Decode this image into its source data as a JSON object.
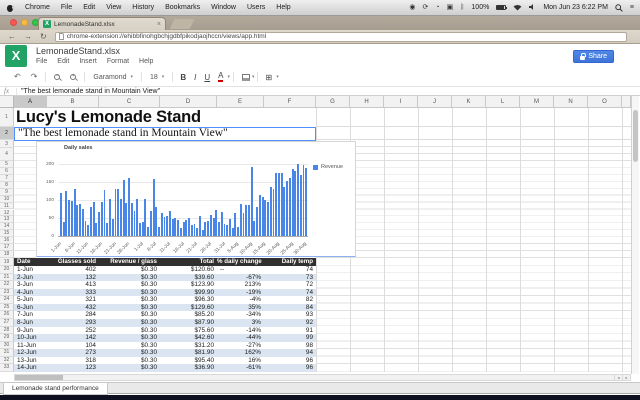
{
  "menubar": {
    "items": [
      "Chrome",
      "File",
      "Edit",
      "View",
      "History",
      "Bookmarks",
      "Window",
      "Users",
      "Help"
    ],
    "battery_label": "100%",
    "clock": "Mon Jun 23  6:22 PM"
  },
  "browser": {
    "tab_title": "LemonadeStand.xlsx",
    "tab_close": "×",
    "url": "chrome-extension://ehibbfinohgbchjgdbfpikodjaojhccn/views/app.html"
  },
  "app": {
    "logo_letter": "X",
    "title": "LemonadeStand.xlsx",
    "menus": [
      "File",
      "Edit",
      "Insert",
      "Format",
      "Help"
    ],
    "share_label": "Share",
    "toolbar": {
      "undo": "↶",
      "redo": "↷",
      "font_name": "Garamond",
      "font_size": "18",
      "bold": "B",
      "italic": "I",
      "underline": "U",
      "text_color": "A",
      "borders": "⊞",
      "caret": "▾"
    }
  },
  "formula_bar": {
    "fx_label": "fx",
    "value": "\"The best lemonade stand in Mountain View\""
  },
  "sheet": {
    "column_letters": [
      "A",
      "B",
      "C",
      "D",
      "E",
      "F",
      "G",
      "H",
      "I",
      "J",
      "K",
      "L",
      "M",
      "N",
      "O"
    ],
    "selected_column": "A",
    "selected_row": "2",
    "row_numbers": [
      "1",
      "2",
      "3",
      "4",
      "5",
      "6",
      "7",
      "8",
      "9",
      "10",
      "11",
      "12",
      "13",
      "14",
      "15",
      "16",
      "17",
      "18",
      "19",
      "20",
      "21",
      "22",
      "23",
      "24",
      "25",
      "26",
      "27",
      "28",
      "29",
      "30",
      "31",
      "32",
      "33"
    ],
    "title_cell": "Lucy's Lemonade Stand",
    "subtitle_cell": "\"The best lemonade stand in Mountain View\"",
    "tab_name": "Lemonade stand performance",
    "table": {
      "headers": [
        "Date",
        "Glasses sold",
        "Revenue / glass",
        "Total",
        "% daily change",
        "Daily temp"
      ],
      "rows": [
        [
          "1-Jun",
          "402",
          "$0.30",
          "$120.60",
          "--",
          "74"
        ],
        [
          "2-Jun",
          "132",
          "$0.30",
          "$39.60",
          "-67%",
          "73"
        ],
        [
          "3-Jun",
          "413",
          "$0.30",
          "$123.90",
          "213%",
          "72"
        ],
        [
          "4-Jun",
          "333",
          "$0.30",
          "$99.90",
          "-19%",
          "74"
        ],
        [
          "5-Jun",
          "321",
          "$0.30",
          "$96.30",
          "-4%",
          "82"
        ],
        [
          "6-Jun",
          "432",
          "$0.30",
          "$129.60",
          "35%",
          "84"
        ],
        [
          "7-Jun",
          "284",
          "$0.30",
          "$85.20",
          "-34%",
          "93"
        ],
        [
          "8-Jun",
          "293",
          "$0.30",
          "$87.90",
          "3%",
          "92"
        ],
        [
          "9-Jun",
          "252",
          "$0.30",
          "$75.60",
          "-14%",
          "91"
        ],
        [
          "10-Jun",
          "142",
          "$0.30",
          "$42.60",
          "-44%",
          "99"
        ],
        [
          "11-Jun",
          "104",
          "$0.30",
          "$31.20",
          "-27%",
          "98"
        ],
        [
          "12-Jun",
          "273",
          "$0.30",
          "$81.90",
          "162%",
          "94"
        ],
        [
          "13-Jun",
          "318",
          "$0.30",
          "$95.40",
          "16%",
          "96"
        ],
        [
          "14-Jun",
          "123",
          "$0.30",
          "$36.90",
          "-61%",
          "96"
        ]
      ]
    }
  },
  "chart_data": {
    "type": "bar",
    "title": "Daily sales",
    "legend": [
      "Revenue"
    ],
    "bar_color": "#4a86e8",
    "ylim": [
      0,
      200
    ],
    "yticks": [
      0,
      50,
      100,
      150,
      200
    ],
    "tick_every": 5,
    "tick_labels": [
      "1-Jun",
      "6-Jun",
      "11-Jun",
      "16-Jun",
      "21-Jun",
      "26-Jun",
      "1-Jul",
      "6-Jul",
      "11-Jul",
      "16-Jul",
      "21-Jul",
      "26-Jul",
      "31-Jul",
      "5-Aug",
      "10-Aug",
      "15-Aug",
      "20-Aug",
      "25-Aug",
      "30-Aug"
    ],
    "values": [
      120.6,
      39.6,
      123.9,
      99.9,
      96.3,
      129.6,
      85.2,
      87.9,
      75.6,
      42.6,
      31.2,
      81.9,
      95.4,
      36.9,
      68,
      94,
      129,
      37,
      102,
      46,
      131,
      130,
      102,
      155,
      92,
      161,
      93,
      70,
      104,
      36,
      38,
      102,
      25,
      69,
      159,
      80,
      26,
      63,
      52,
      55,
      70,
      47,
      50,
      45,
      21,
      40,
      45,
      51,
      30,
      34,
      23,
      56,
      16,
      38,
      42,
      59,
      50,
      71,
      38,
      67,
      33,
      30,
      46,
      22,
      63,
      26,
      88,
      64,
      86,
      87,
      193,
      42,
      81,
      115,
      108,
      100,
      95,
      135,
      131,
      174,
      174,
      176,
      135,
      152,
      161,
      185,
      181,
      200,
      170,
      196,
      190
    ]
  }
}
